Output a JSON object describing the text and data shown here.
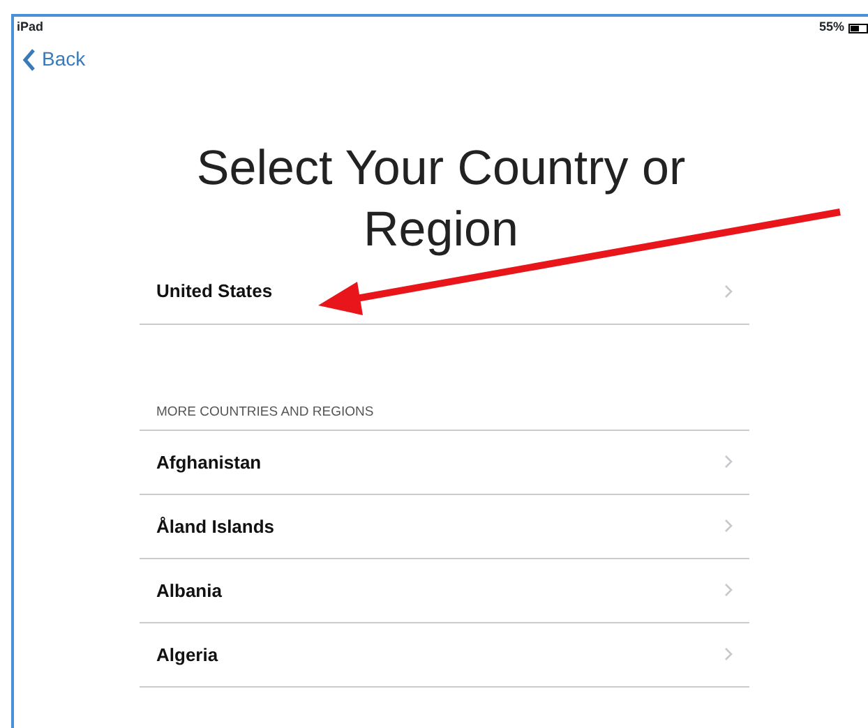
{
  "status_bar": {
    "device": "iPad",
    "battery": "55%"
  },
  "nav": {
    "back": "Back"
  },
  "title": "Select Your Country or Region",
  "suggested": [
    {
      "name": "United States"
    }
  ],
  "section": {
    "header": "MORE COUNTRIES AND REGIONS",
    "items": [
      {
        "name": "Afghanistan"
      },
      {
        "name": "Åland Islands"
      },
      {
        "name": "Albania"
      },
      {
        "name": "Algeria"
      }
    ]
  }
}
